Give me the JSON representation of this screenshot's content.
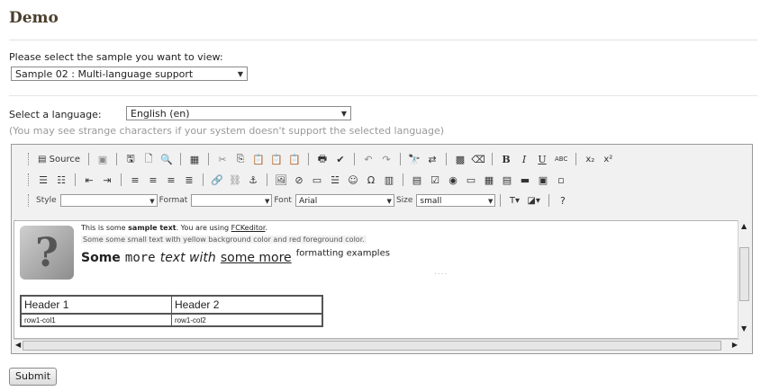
{
  "page": {
    "title": "Demo",
    "sample_prompt": "Please select the sample you want to view:",
    "sample_selected": "Sample 02 : Multi-language support",
    "language_label": "Select a language:",
    "language_selected": "English (en)",
    "language_hint": "(You may see strange characters if your system doesn't support the selected language)",
    "submit_label": "Submit"
  },
  "toolbar": {
    "source_label": "Source",
    "style_label": "Style",
    "style_value": "",
    "format_label": "Format",
    "format_value": "",
    "font_label": "Font",
    "font_value": "Arial",
    "size_label": "Size",
    "size_value": "small",
    "bold_label": "B",
    "italic_label": "I",
    "underline_label": "U",
    "abc_label": "ABC",
    "sub_label": "x₂",
    "sup_label": "x²"
  },
  "content": {
    "line1_a": "This is some ",
    "line1_b": "sample text",
    "line1_c": ". You are using ",
    "line1_link": "FCKeditor",
    "line1_d": ".",
    "line2": "Some some small text with yellow background color and red foreground color.",
    "line3_s1": "Some",
    "line3_s2": "more",
    "line3_s3": "text with",
    "line3_s4": "some more",
    "line3_s5": "formatting examples",
    "dots": "....",
    "table": {
      "headers": [
        "Header 1",
        "Header 2"
      ],
      "row1": [
        "row1-col1",
        "row1-col2"
      ]
    }
  },
  "icons": {
    "question_image": "?"
  }
}
